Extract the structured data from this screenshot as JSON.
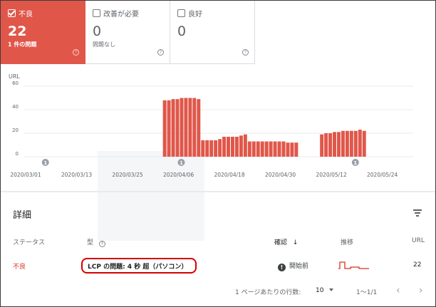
{
  "cards": [
    {
      "label": "不良",
      "count": "22",
      "sub": "1 件の問題",
      "active": true
    },
    {
      "label": "改善が必要",
      "count": "0",
      "sub": "問題なし",
      "active": false
    },
    {
      "label": "良好",
      "count": "0",
      "sub": "",
      "active": false
    }
  ],
  "help_glyph": "?",
  "chart_data": {
    "type": "bar",
    "ylabel": "URL",
    "yticks": [
      "60",
      "40",
      "20",
      "0"
    ],
    "ylim": [
      0,
      60
    ],
    "xticks": [
      "2020/03/01",
      "2020/03/13",
      "2020/03/25",
      "2020/04/06",
      "2020/04/18",
      "2020/04/30",
      "2020/05/12",
      "2020/05/24"
    ],
    "annotation_label": "1",
    "annotations_at_day": [
      6,
      38,
      79
    ],
    "color": "#e0574a",
    "series": [
      {
        "start_day": 34,
        "values": [
          48,
          48,
          49,
          49,
          50,
          50,
          50,
          50,
          49
        ]
      },
      {
        "start_day": 43,
        "values": [
          14,
          14,
          14,
          14,
          15,
          17,
          17,
          17,
          17,
          18,
          19,
          13,
          13,
          13,
          13,
          13,
          13,
          13,
          13,
          13,
          12,
          12,
          12
        ]
      },
      {
        "start_day": 71,
        "values": [
          19,
          20,
          20,
          21,
          21,
          22,
          22,
          22,
          22,
          23,
          22
        ]
      }
    ]
  },
  "details": {
    "title": "詳細",
    "columns": {
      "status": "ステータス",
      "type": "型",
      "confirm": "確認",
      "trend": "推移",
      "url": "URL"
    },
    "row": {
      "status": "不良",
      "type": "LCP の問題: 4 秒 超（パソコン）",
      "confirm": "開始前",
      "confirm_icon": "!",
      "url": "22"
    },
    "sort_arrow": "↓"
  },
  "footer": {
    "rows_label": "1 ページあたりの行数:",
    "rows_value": "10",
    "range": "1〜1/1",
    "prev": "‹",
    "next": "›"
  }
}
